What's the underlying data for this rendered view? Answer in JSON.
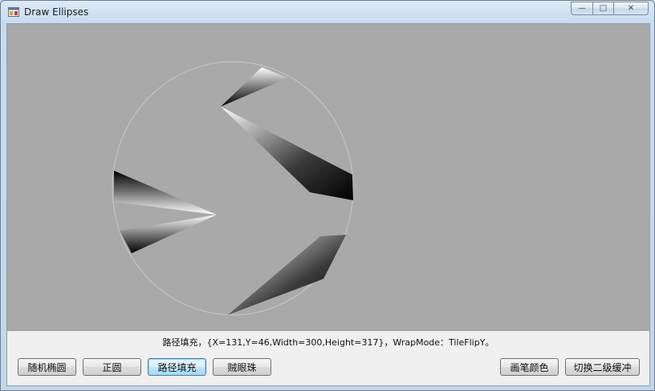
{
  "window": {
    "title": "Draw Ellipses",
    "min_glyph": "—",
    "max_glyph": "□",
    "close_glyph": "✕"
  },
  "canvas": {
    "background": "#a9a9a9",
    "outline_color": "#c8c8c8"
  },
  "status": {
    "text": "路径填充，{X=131,Y=46,Width=300,Height=317}，WrapMode：TileFlipY。"
  },
  "buttons": {
    "random_ellipse": "随机椭圆",
    "circle": "正圆",
    "path_fill": "路径填充",
    "thief_eye": "贼眼珠",
    "pen_color": "画笔颜色",
    "toggle_double_buffer": "切换二级缓冲"
  }
}
